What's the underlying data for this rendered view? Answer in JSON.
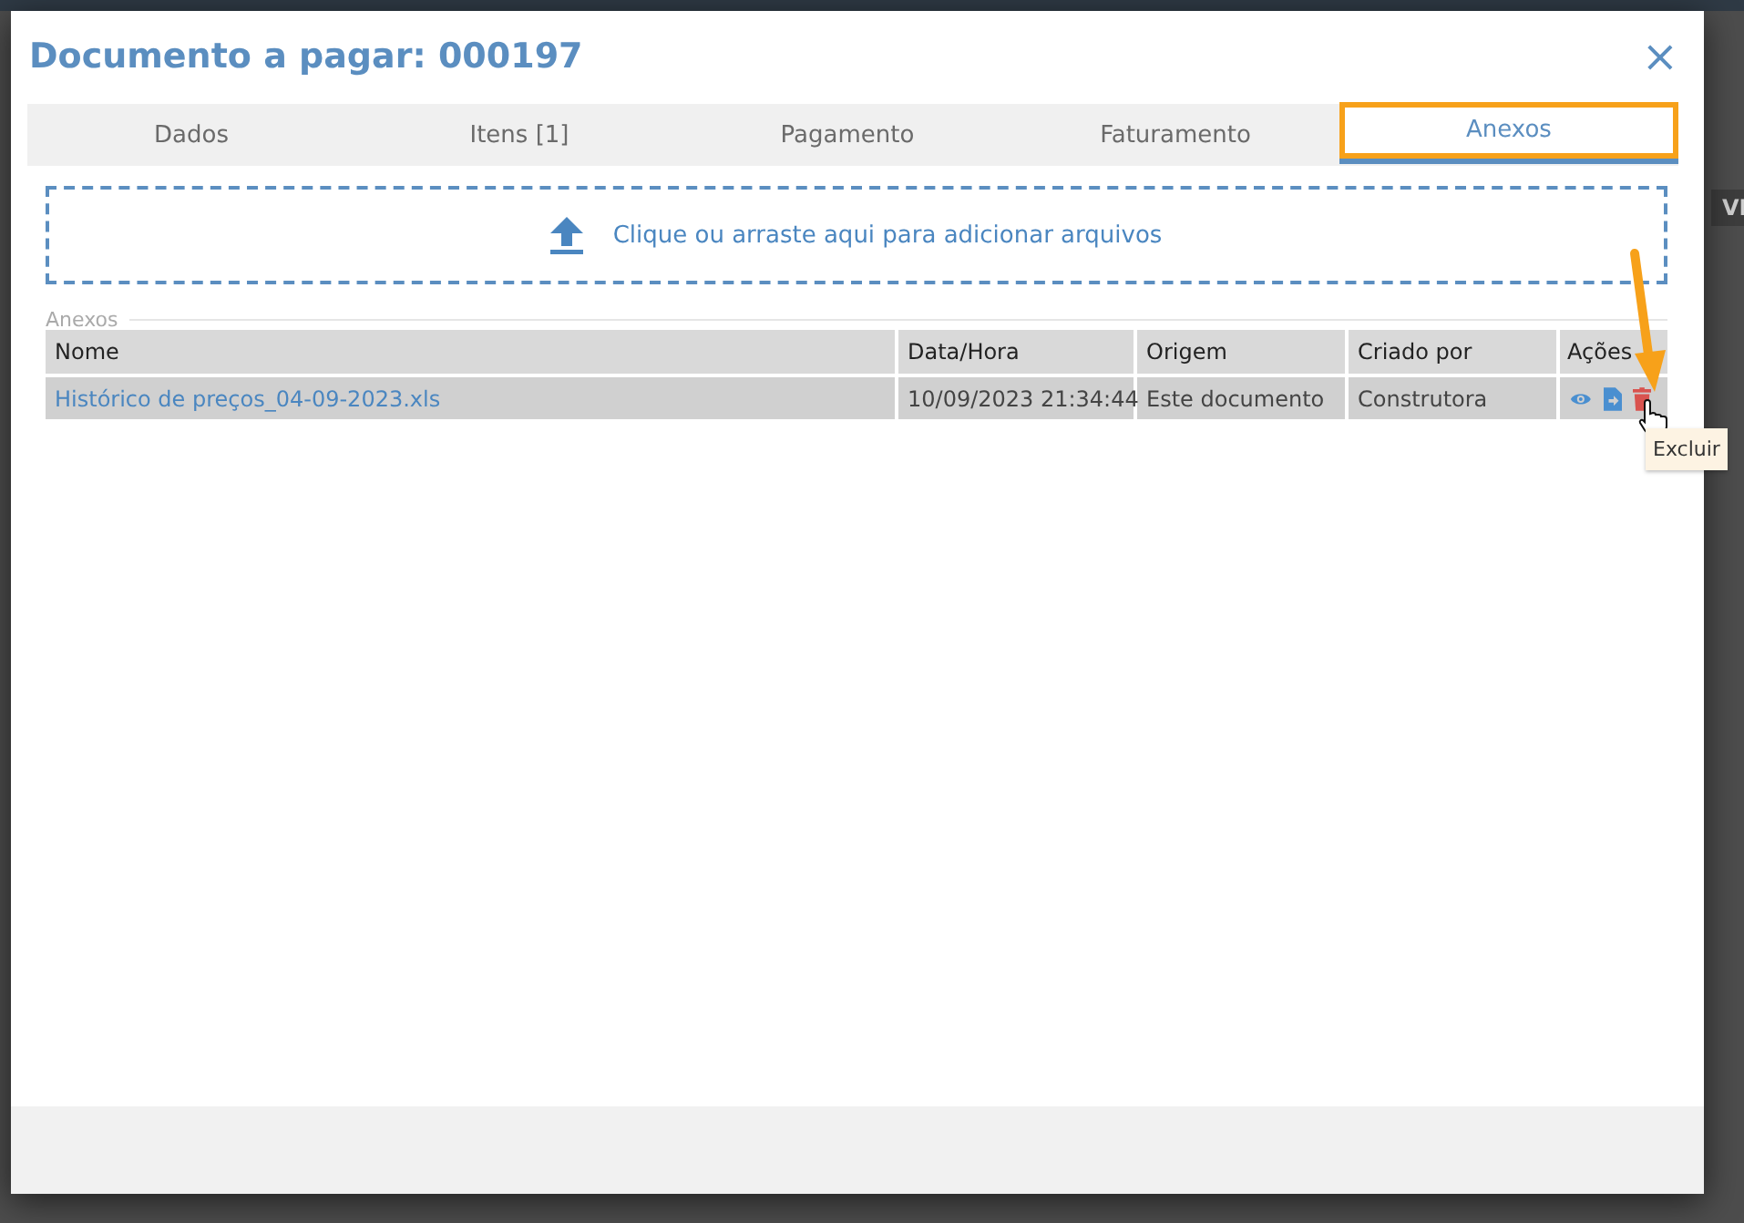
{
  "backdrop": {
    "fragment": "VI"
  },
  "dialog": {
    "title": "Documento a pagar: 000197",
    "close": "×"
  },
  "tabs": [
    {
      "label": "Dados",
      "selected": false
    },
    {
      "label": "Itens [1]",
      "selected": false
    },
    {
      "label": "Pagamento",
      "selected": false
    },
    {
      "label": "Faturamento",
      "selected": false
    },
    {
      "label": "Anexos",
      "selected": true
    }
  ],
  "dropzone": {
    "text": "Clique ou arraste aqui para adicionar arquivos"
  },
  "attachments": {
    "legend": "Anexos",
    "columns": [
      "Nome",
      "Data/Hora",
      "Origem",
      "Criado por",
      "Ações"
    ],
    "rows": [
      {
        "name": "Histórico de preços_04-09-2023.xls",
        "datetime": "10/09/2023 21:34:44",
        "origin": "Este documento",
        "created_by": "Construtora",
        "actions": [
          {
            "kind": "view"
          },
          {
            "kind": "download"
          },
          {
            "kind": "delete"
          }
        ]
      }
    ]
  },
  "tooltip": {
    "text": "Excluir"
  }
}
